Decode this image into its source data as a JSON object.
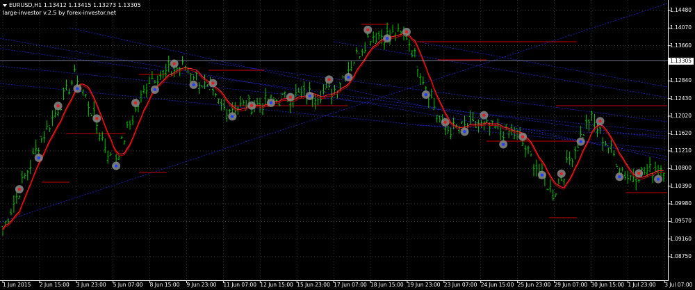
{
  "header": {
    "symbol_title": "EURUSD,H1  1.13412 1.13415 1.13273 1.13305",
    "indicator_title": "large-investor v.2.5 by forex-investor.net"
  },
  "price_axis": {
    "labels": [
      "1.14480",
      "1.14070",
      "1.13660",
      "1.12840",
      "1.12430",
      "1.12020",
      "1.11620",
      "1.11210",
      "1.10800",
      "1.10390",
      "1.09980",
      "1.09570",
      "1.09160",
      "1.08750"
    ],
    "current_price": "1.13305"
  },
  "time_axis": {
    "labels": [
      "1 Jun 2015",
      "2 Jun 15:00",
      "3 Jun 23:00",
      "5 Jun 07:00",
      "8 Jun 15:00",
      "9 Jun 23:00",
      "11 Jun 07:00",
      "12 Jun 15:00",
      "15 Jun 23:00",
      "17 Jun 07:00",
      "18 Jun 15:00",
      "19 Jun 23:00",
      "23 Jun 07:00",
      "24 Jun 15:00",
      "25 Jun 23:00",
      "29 Jun 07:00",
      "30 Jun 15:00",
      "1 Jul 23:00",
      "3 Jul 07:00"
    ]
  },
  "colors": {
    "background": "#000000",
    "grid": "#4a4a4a",
    "bars": "#00c800",
    "ma_line": "#ff2020",
    "trend_lines": "#1e28c8",
    "level_lines": "#c80000",
    "signal_marker": "#8a8a8a",
    "current_price_line": "#9aa0b4"
  },
  "chart_data": {
    "type": "line",
    "title": "EURUSD,H1",
    "instrument": "EURUSD",
    "timeframe": "H1",
    "last_bar": {
      "open": 1.13412,
      "high": 1.13415,
      "low": 1.13273,
      "close": 1.13305
    },
    "ylim": [
      1.0875,
      1.1469
    ],
    "x": [
      "1 Jun 2015",
      "2 Jun 15:00",
      "3 Jun 23:00",
      "5 Jun 07:00",
      "8 Jun 15:00",
      "9 Jun 23:00",
      "11 Jun 07:00",
      "12 Jun 15:00",
      "15 Jun 23:00",
      "17 Jun 07:00",
      "18 Jun 15:00",
      "19 Jun 23:00",
      "23 Jun 07:00",
      "24 Jun 15:00",
      "25 Jun 23:00",
      "29 Jun 07:00",
      "30 Jun 15:00",
      "1 Jul 23:00",
      "3 Jul 07:00"
    ],
    "series": [
      {
        "values": [
          1.094,
          1.114,
          1.13,
          1.109,
          1.129,
          1.132,
          1.122,
          1.123,
          1.125,
          1.126,
          1.139,
          1.139,
          1.117,
          1.118,
          1.116,
          1.102,
          1.12,
          1.106,
          1.1085
        ]
      }
    ],
    "grid": true
  }
}
